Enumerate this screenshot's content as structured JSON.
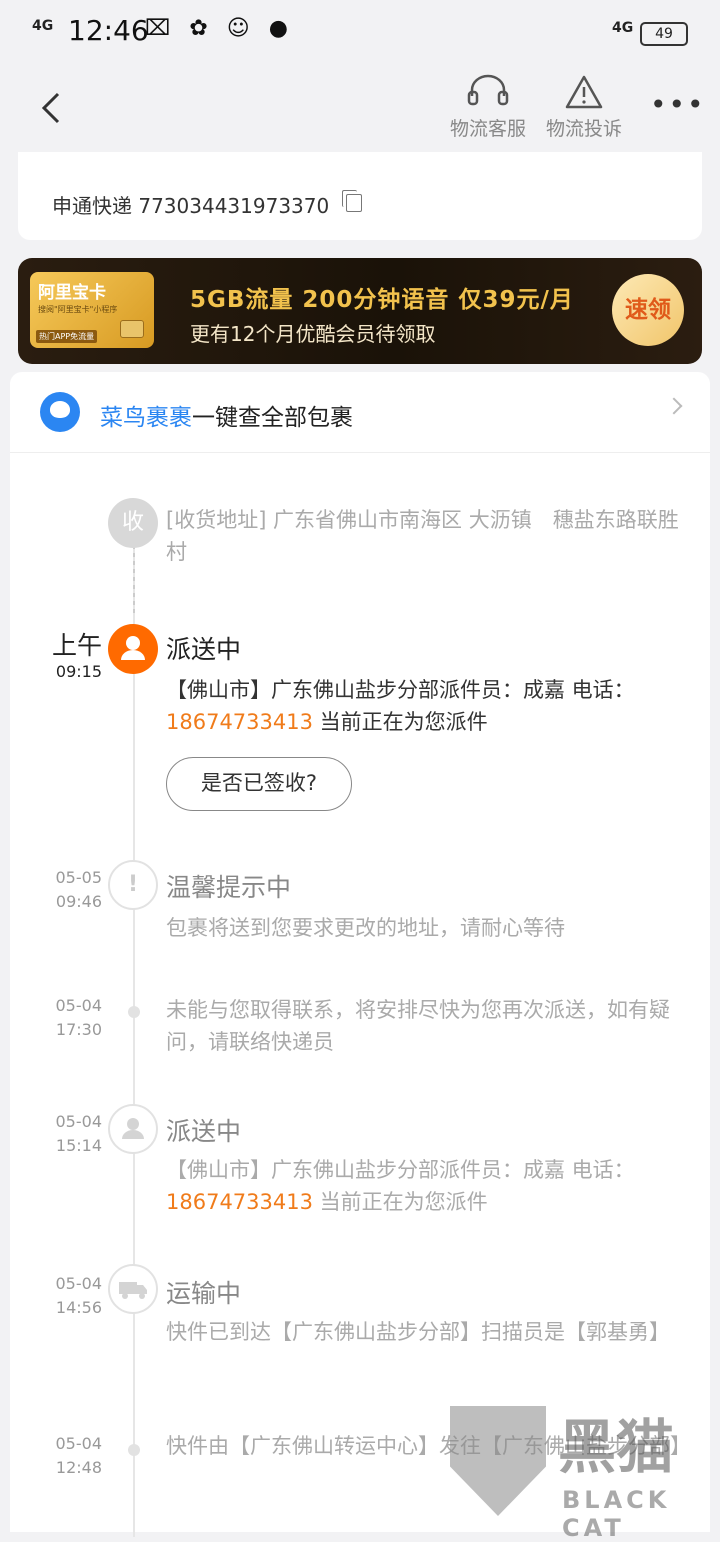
{
  "status_bar": {
    "signal": "4G",
    "time": "12:46",
    "app_icons": "⌧ ✿ ☺ ●",
    "net": "4G",
    "battery": "49"
  },
  "nav": {
    "service_label": "物流客服",
    "complaint_label": "物流投诉"
  },
  "tracking": {
    "text": "申通快递 773034431973370"
  },
  "banner": {
    "card_title": "阿里宝卡",
    "card_sub": "搜阅\"阿里宝卡\"小程序",
    "card_tag": "热门APP免流量",
    "line1": "5GB流量 200分钟语音 仅39元/月",
    "line2": "更有12个月优酷会员待领取",
    "cta": "速领"
  },
  "cainiao": {
    "brand": "菜鸟裹裹",
    "text": "一键查全部包裹"
  },
  "timeline": {
    "address": {
      "icon_text": "收",
      "text": "[收货地址] 广东省佛山市南海区 大沥镇　穗盐东路联胜村"
    },
    "e1": {
      "time_big": "上午",
      "time_small": "09:15",
      "title": "派送中",
      "body_pre": "【佛山市】广东佛山盐步分部派件员：成嘉 电话：",
      "phone": "18674733413",
      "body_post": " 当前正在为您派件",
      "button": "是否已签收?"
    },
    "e2": {
      "date": "05-05",
      "time": "09:46",
      "title": "温馨提示中",
      "body": "包裹将送到您要求更改的地址，请耐心等待"
    },
    "e3": {
      "date": "05-04",
      "time": "17:30",
      "body": "未能与您取得联系，将安排尽快为您再次派送，如有疑问，请联络快递员"
    },
    "e4": {
      "date": "05-04",
      "time": "15:14",
      "title": "派送中",
      "body_pre": "【佛山市】广东佛山盐步分部派件员：成嘉 电话：",
      "phone": "18674733413",
      "body_post": " 当前正在为您派件"
    },
    "e5": {
      "date": "05-04",
      "time": "14:56",
      "title": "运输中",
      "body": "快件已到达【广东佛山盐步分部】扫描员是【郭基勇】"
    },
    "e6": {
      "date": "05-04",
      "time": "12:48",
      "body": "快件由【广东佛山转运中心】发往【广东佛山盐步分部】"
    }
  },
  "watermark": {
    "cn": "黑猫",
    "en": "BLACK CAT"
  }
}
